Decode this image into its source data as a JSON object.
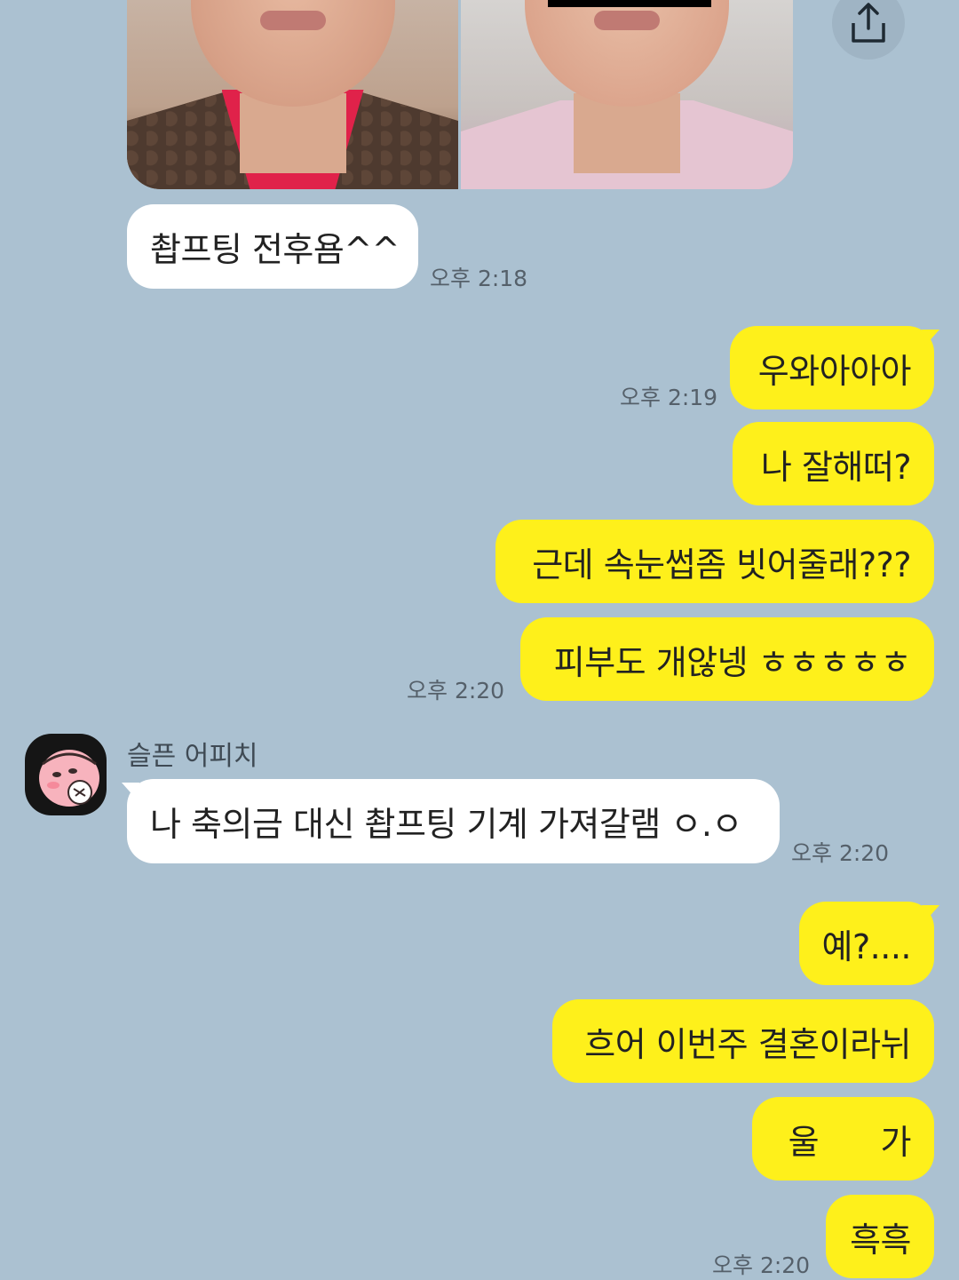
{
  "colors": {
    "background": "#abc1d1",
    "sent_bubble": "#fef01b",
    "received_bubble": "#ffffff",
    "time_text": "#55606a"
  },
  "header": {
    "share_icon": "share-icon"
  },
  "photo_message": {
    "left_photo": "before-photo",
    "right_photo": "after-photo"
  },
  "messages": [
    {
      "side": "received",
      "text": "촵프팅 전후욤^^",
      "time": "오후 2:18"
    },
    {
      "side": "sent",
      "text": "우와아아아",
      "time": "오후 2:19"
    },
    {
      "side": "sent",
      "text": "나 잘해떠?",
      "time": ""
    },
    {
      "side": "sent",
      "text": "근데 속눈썹좀 빗어줄래???",
      "time": ""
    },
    {
      "side": "sent",
      "text": "피부도 개않넹 ㅎㅎㅎㅎㅎ",
      "time": "오후 2:20"
    },
    {
      "side": "received",
      "sender": "슬픈 어피치",
      "text": "나 축의금 대신 촵프팅 기계 가져갈램 ㅇ.ㅇ",
      "time": "오후 2:20"
    },
    {
      "side": "sent",
      "text": "예?....",
      "time": ""
    },
    {
      "side": "sent",
      "text": "흐어 이번주 결혼이라뉘",
      "time": ""
    },
    {
      "side": "sent",
      "text": "울      가",
      "time": ""
    },
    {
      "side": "sent",
      "text": "흑흑",
      "time": "오후 2:20"
    }
  ]
}
